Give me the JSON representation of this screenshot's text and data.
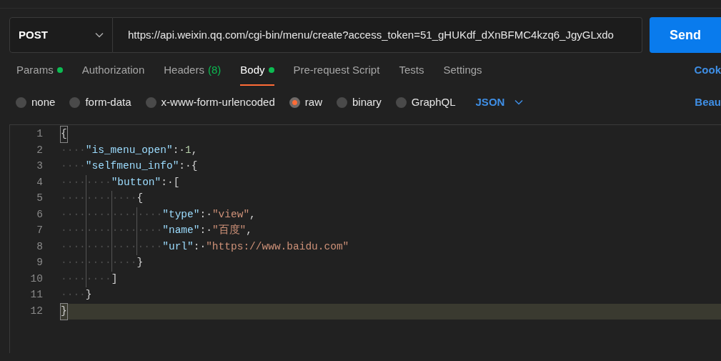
{
  "request": {
    "method": "POST",
    "url": "https://api.weixin.qq.com/cgi-bin/menu/create?access_token=51_gHUKdf_dXnBFMC4kzq6_JgyGLxdo",
    "send": "Send"
  },
  "tabs": [
    {
      "label": "Params",
      "has_content": true,
      "selected": false
    },
    {
      "label": "Authorization",
      "has_content": false,
      "selected": false
    },
    {
      "label": "Headers",
      "count": "(8)",
      "has_content": false,
      "selected": false
    },
    {
      "label": "Body",
      "has_content": true,
      "selected": true
    },
    {
      "label": "Pre-request Script",
      "has_content": false,
      "selected": false
    },
    {
      "label": "Tests",
      "has_content": false,
      "selected": false
    },
    {
      "label": "Settings",
      "has_content": false,
      "selected": false
    }
  ],
  "tabs_right_link": "Cook",
  "body_types": [
    {
      "label": "none",
      "selected": false
    },
    {
      "label": "form-data",
      "selected": false
    },
    {
      "label": "x-www-form-urlencoded",
      "selected": false
    },
    {
      "label": "raw",
      "selected": true
    },
    {
      "label": "binary",
      "selected": false
    },
    {
      "label": "GraphQL",
      "selected": false
    }
  ],
  "format_dropdown": "JSON",
  "beautify_link": "Beau",
  "editor": {
    "lines": [
      {
        "number": "1",
        "current": false,
        "tokens": [
          {
            "kind": "brace-match",
            "text": "{"
          }
        ]
      },
      {
        "number": "2",
        "current": false,
        "tokens": [
          {
            "kind": "indent",
            "text": "····"
          },
          {
            "kind": "key",
            "text": "\"is_menu_open\""
          },
          {
            "kind": "punct",
            "text": ":·"
          },
          {
            "kind": "number",
            "text": "1"
          },
          {
            "kind": "punct",
            "text": ","
          }
        ]
      },
      {
        "number": "3",
        "current": false,
        "tokens": [
          {
            "kind": "indent",
            "text": "····"
          },
          {
            "kind": "key",
            "text": "\"selfmenu_info\""
          },
          {
            "kind": "punct",
            "text": ":·{"
          }
        ]
      },
      {
        "number": "4",
        "current": false,
        "tokens": [
          {
            "kind": "indent",
            "text": "····"
          },
          {
            "kind": "indent",
            "text": "····"
          },
          {
            "kind": "key",
            "text": "\"button\""
          },
          {
            "kind": "punct",
            "text": ":·["
          }
        ]
      },
      {
        "number": "5",
        "current": false,
        "tokens": [
          {
            "kind": "indent",
            "text": "····"
          },
          {
            "kind": "indent",
            "text": "····"
          },
          {
            "kind": "indent",
            "text": "····"
          },
          {
            "kind": "punct",
            "text": "{"
          }
        ]
      },
      {
        "number": "6",
        "current": false,
        "tokens": [
          {
            "kind": "indent",
            "text": "····"
          },
          {
            "kind": "indent",
            "text": "····"
          },
          {
            "kind": "indent",
            "text": "····"
          },
          {
            "kind": "indent",
            "text": "····"
          },
          {
            "kind": "key",
            "text": "\"type\""
          },
          {
            "kind": "punct",
            "text": ":·"
          },
          {
            "kind": "string",
            "text": "\"view\""
          },
          {
            "kind": "punct",
            "text": ","
          }
        ]
      },
      {
        "number": "7",
        "current": false,
        "tokens": [
          {
            "kind": "indent",
            "text": "····"
          },
          {
            "kind": "indent",
            "text": "····"
          },
          {
            "kind": "indent",
            "text": "····"
          },
          {
            "kind": "indent",
            "text": "····"
          },
          {
            "kind": "key",
            "text": "\"name\""
          },
          {
            "kind": "punct",
            "text": ":·"
          },
          {
            "kind": "string",
            "text": "\"百度\""
          },
          {
            "kind": "punct",
            "text": ","
          }
        ]
      },
      {
        "number": "8",
        "current": false,
        "tokens": [
          {
            "kind": "indent",
            "text": "····"
          },
          {
            "kind": "indent",
            "text": "····"
          },
          {
            "kind": "indent",
            "text": "····"
          },
          {
            "kind": "indent",
            "text": "····"
          },
          {
            "kind": "key",
            "text": "\"url\""
          },
          {
            "kind": "punct",
            "text": ":·"
          },
          {
            "kind": "string",
            "text": "\"https://www.baidu.com\""
          }
        ]
      },
      {
        "number": "9",
        "current": false,
        "tokens": [
          {
            "kind": "indent",
            "text": "····"
          },
          {
            "kind": "indent",
            "text": "····"
          },
          {
            "kind": "indent",
            "text": "····"
          },
          {
            "kind": "punct",
            "text": "}"
          }
        ]
      },
      {
        "number": "10",
        "current": false,
        "tokens": [
          {
            "kind": "indent",
            "text": "····"
          },
          {
            "kind": "indent",
            "text": "····"
          },
          {
            "kind": "punct",
            "text": "]"
          }
        ]
      },
      {
        "number": "11",
        "current": false,
        "tokens": [
          {
            "kind": "indent",
            "text": "····"
          },
          {
            "kind": "punct",
            "text": "}"
          }
        ]
      },
      {
        "number": "12",
        "current": true,
        "tokens": [
          {
            "kind": "brace-match",
            "text": "}"
          }
        ]
      }
    ]
  }
}
